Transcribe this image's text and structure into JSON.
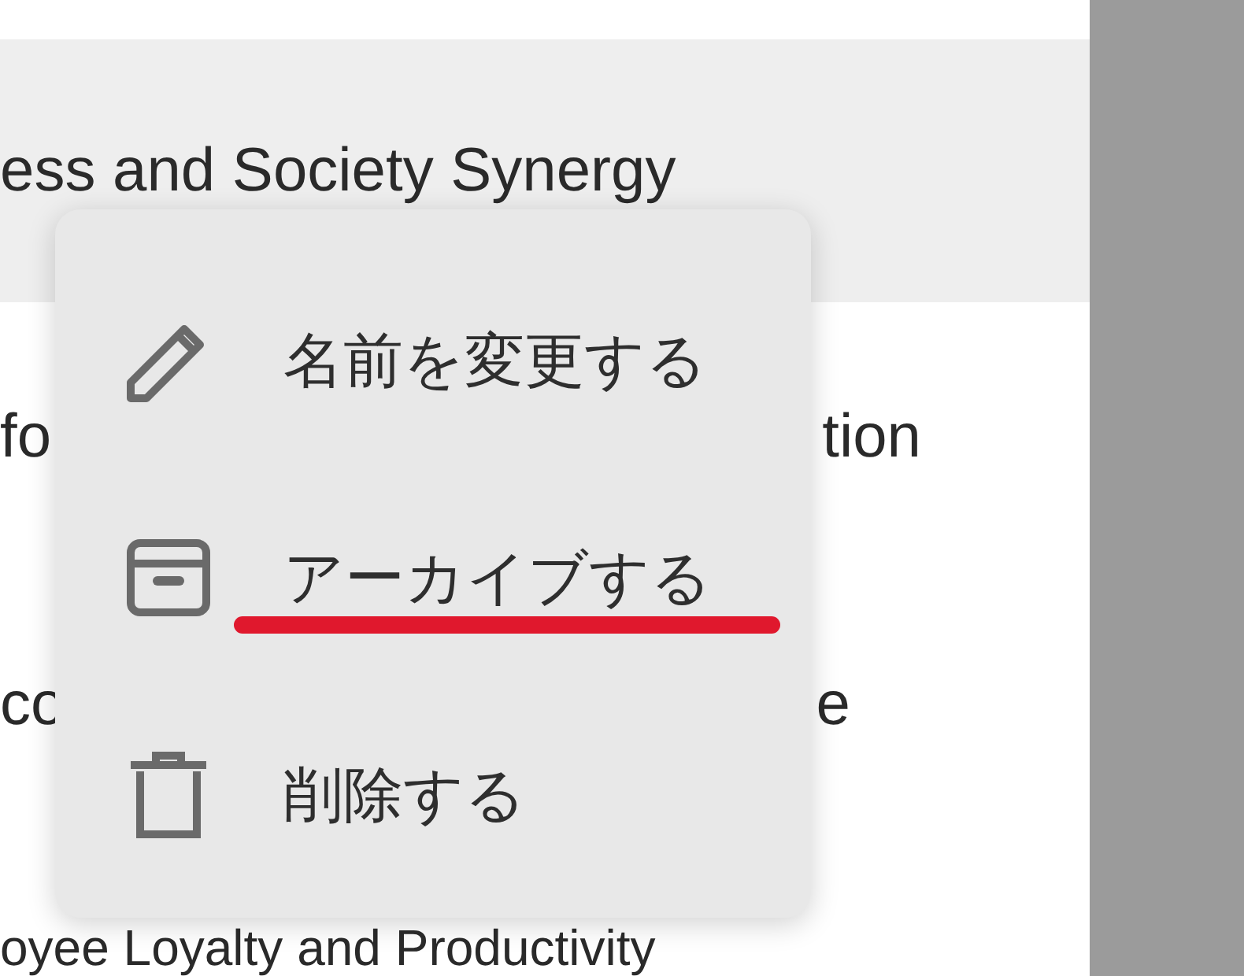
{
  "list": [
    {
      "text": "ess and Society Synergy",
      "selected": true
    },
    {
      "left": "fo",
      "right": "tion",
      "selected": false
    },
    {
      "left": "co",
      "right": "e",
      "selected": false
    },
    {
      "text": "oyee Loyalty and Productivity",
      "selected": false
    }
  ],
  "menu": [
    {
      "kind": "pencil",
      "label": "名前を変更する",
      "underlined": false
    },
    {
      "kind": "archive",
      "label": "アーカイブする",
      "underlined": true
    },
    {
      "kind": "trash",
      "label": "削除する",
      "underlined": false
    }
  ]
}
